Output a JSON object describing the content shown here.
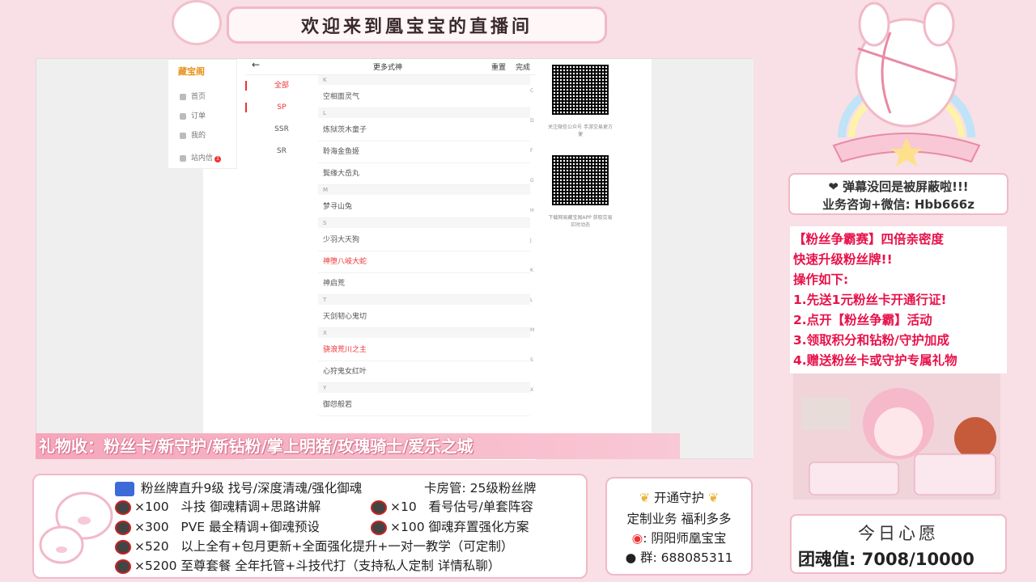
{
  "banner": {
    "title": "欢迎来到凰宝宝的直播间"
  },
  "game": {
    "logo": "藏宝阁",
    "nav": [
      {
        "label": "首页"
      },
      {
        "label": "订单"
      },
      {
        "label": "我的"
      },
      {
        "label": "站内信",
        "badge": "1"
      }
    ],
    "header": {
      "back": "←",
      "title": "更多式神",
      "reset": "重置",
      "done": "完成"
    },
    "categories": [
      "全部",
      "SP",
      "SSR",
      "SR"
    ],
    "selected_categories": [
      "全部",
      "SP"
    ],
    "list": [
      {
        "type": "header",
        "text": "K"
      },
      {
        "type": "item",
        "text": "空相面灵气"
      },
      {
        "type": "header",
        "text": "L"
      },
      {
        "type": "item",
        "text": "炼狱茨木童子"
      },
      {
        "type": "item",
        "text": "聆海金鱼姬"
      },
      {
        "type": "item",
        "text": "鬓缘大岳丸"
      },
      {
        "type": "header",
        "text": "M"
      },
      {
        "type": "item",
        "text": "梦寻山兔"
      },
      {
        "type": "header",
        "text": "S"
      },
      {
        "type": "item",
        "text": "少羽大天狗"
      },
      {
        "type": "item",
        "text": "神堕八岐大蛇",
        "red": true
      },
      {
        "type": "item",
        "text": "神启荒"
      },
      {
        "type": "header",
        "text": "T"
      },
      {
        "type": "item",
        "text": "天剑韧心鬼切"
      },
      {
        "type": "header",
        "text": "X"
      },
      {
        "type": "item",
        "text": "骁浪荒川之主",
        "red": true
      },
      {
        "type": "item",
        "text": "心狩鬼女红叶"
      },
      {
        "type": "header",
        "text": "Y"
      },
      {
        "type": "item",
        "text": "御怨般若"
      }
    ],
    "index_letters": [
      "C",
      "D",
      "F",
      "G",
      "H",
      "J",
      "K",
      "L",
      "M",
      "S",
      "X"
    ],
    "qr": [
      {
        "caption": "关注微信公众号 手游交易更方便"
      },
      {
        "caption": "下载网易藏宝阁APP 获取交易实时动态"
      }
    ]
  },
  "gift_strip": "礼物收：粉丝卡/新守护/新钻粉/掌上明猪/玫瑰骑士/爱乐之城",
  "notice": {
    "line1": "❤ 弹幕没回是被屏蔽啦!!!",
    "line2": "业务咨询+微信: Hbb666z"
  },
  "rules": [
    "【粉丝争霸赛】四倍亲密度",
    "快速升级粉丝牌!!",
    "操作如下:",
    "1.先送1元粉丝卡开通行证!",
    "2.点开【粉丝争霸】活动",
    "3.领取积分和钻粉/守护加成",
    "4.赠送粉丝卡或守护专属礼物"
  ],
  "wish": {
    "title": "今日心愿",
    "label": "团魂值:",
    "current": "7008",
    "target": "10000"
  },
  "tiers": {
    "top": "粉丝牌直升9级 找号/深度清魂/强化御魂",
    "top_right": "卡房管: 25级粉丝牌",
    "rows": [
      {
        "mult": "×100",
        "text": "斗技 御魂精调+思路讲解"
      },
      {
        "mult": "×300",
        "text": "PVE 最全精调+御魂预设"
      },
      {
        "mult": "×520",
        "text": "以上全有+包月更新+全面强化提升+一对一教学（可定制）"
      },
      {
        "mult": "×5200",
        "text": "至尊套餐 全年托管+斗技代打（支持私人定制 详情私聊）"
      }
    ],
    "right_rows": [
      {
        "mult": "×10",
        "text": "看号估号/单套阵容"
      },
      {
        "mult": "×100",
        "text": "御魂弃置强化方案"
      }
    ]
  },
  "contact": {
    "guard": "开通守护",
    "custom": "定制业务 福利多多",
    "weibo": ": 阴阳师凰宝宝",
    "qq_group": "群: 688085311"
  },
  "colors": {
    "accent_pink": "#f1b9c8",
    "rule_red": "#e8124a",
    "list_red": "#e33333"
  }
}
